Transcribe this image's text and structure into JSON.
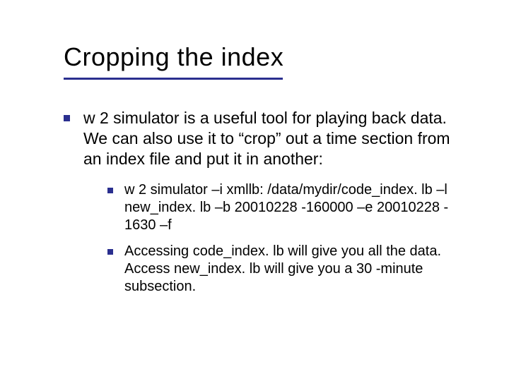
{
  "colors": {
    "accent": "#2a2f8f"
  },
  "title": "Cropping the index",
  "bullets": [
    {
      "text": "w 2 simulator is a useful tool for playing back data.  We can also use it to “crop” out a time section from an index file and put it in another:",
      "children": [
        {
          "text": "w 2 simulator –i xmllb: /data/mydir/code_index. lb –l new_index. lb –b 20010228 -160000 –e 20010228 - 1630 –f"
        },
        {
          "text": "Accessing code_index. lb will give you all the data. Access new_index. lb will give you a 30 -minute subsection."
        }
      ]
    }
  ]
}
